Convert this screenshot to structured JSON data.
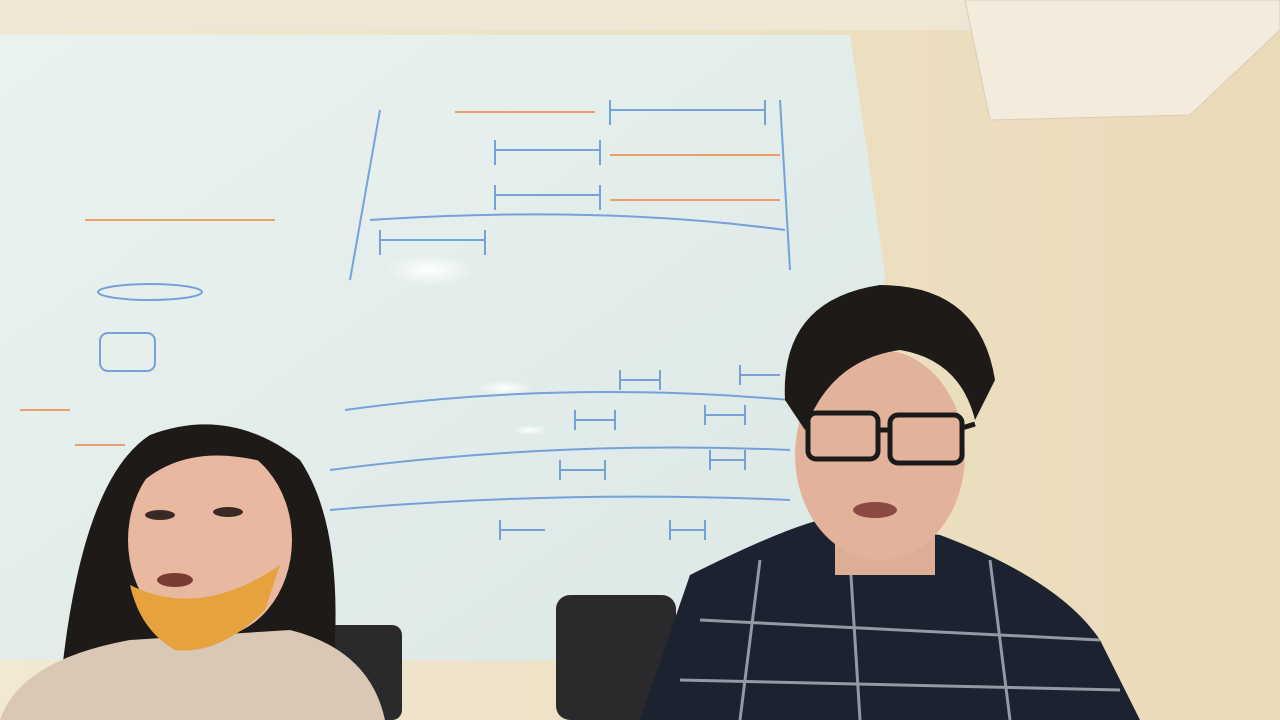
{
  "scene": {
    "colors": {
      "wall": "#efe3c6",
      "whiteboard": "#e4efec",
      "blue_marker": "#5b8fd6",
      "orange_marker": "#f08a4a",
      "hair": "#1e1a18",
      "skin": "#e8b9a0",
      "mask": "#e6a23c",
      "sweater": "#d9c8b6",
      "shirt": "#1c2230",
      "chair": "#2a2a2c"
    }
  }
}
